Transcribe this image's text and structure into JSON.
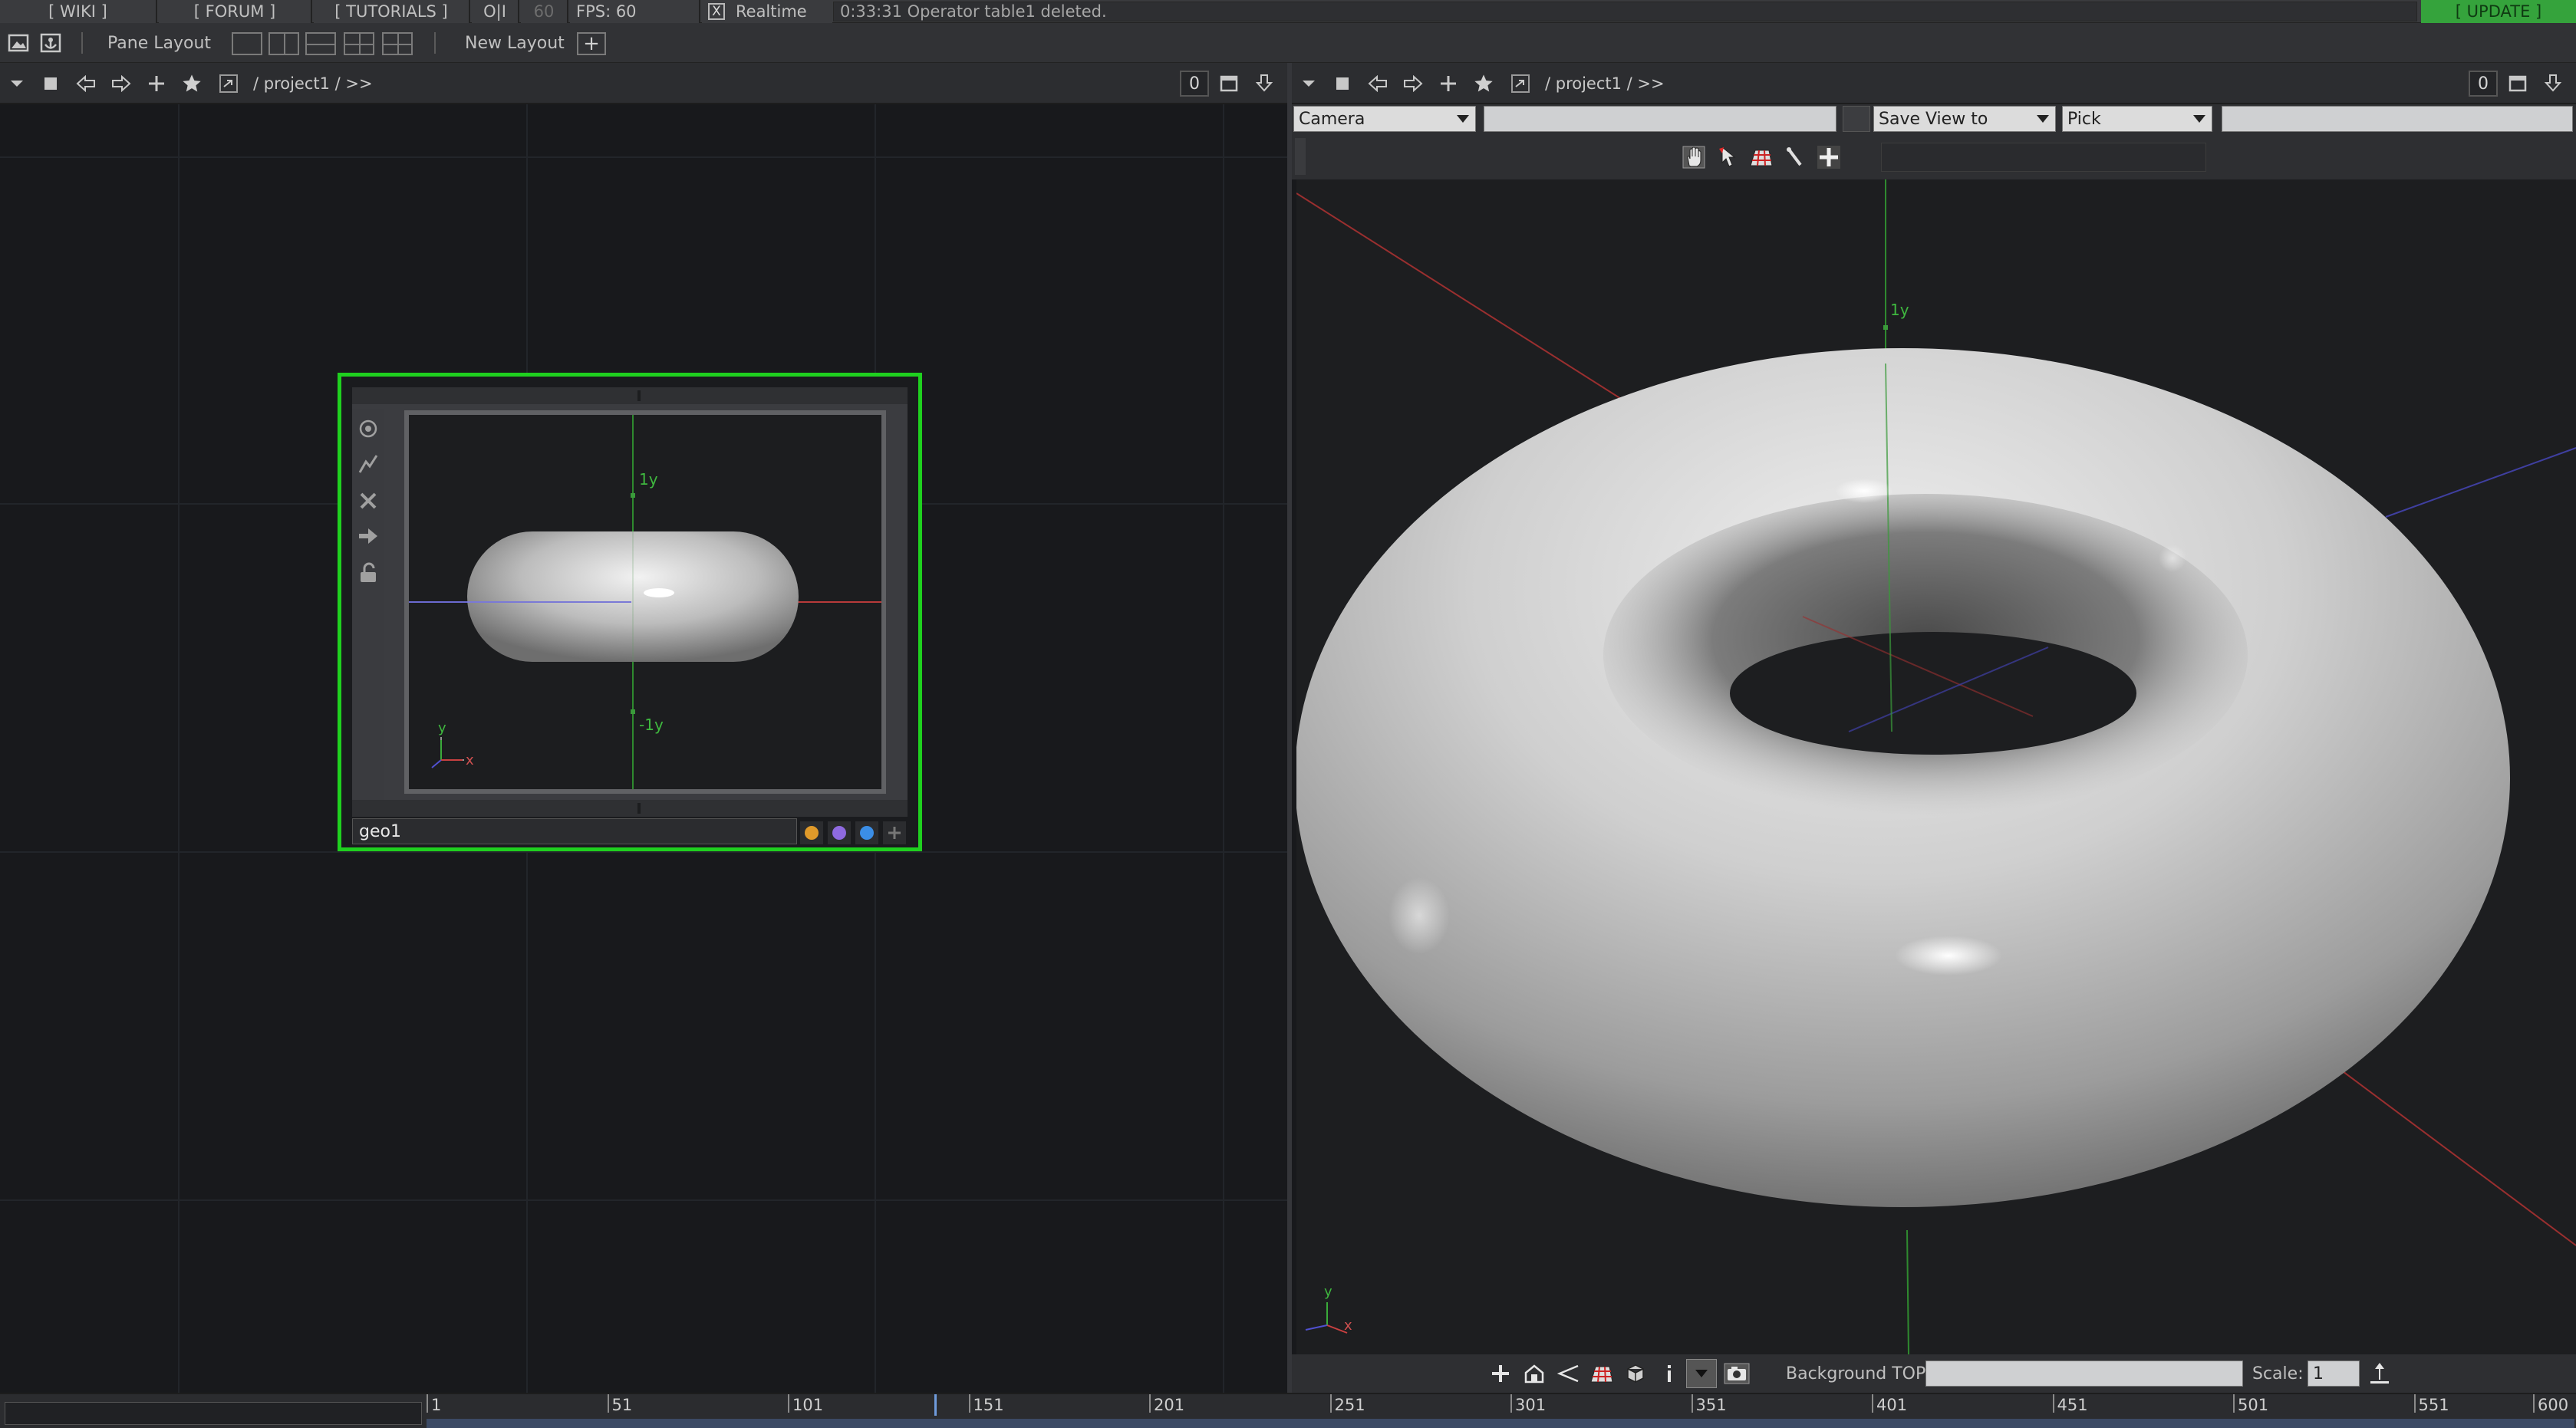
{
  "topbar": {
    "wiki": "[ WIKI ]",
    "forum": "[ FORUM ]",
    "tutorials": "[ TUTORIALS ]",
    "oi": "O|I",
    "fps_cap": "60",
    "fps": "FPS:  60",
    "realtime_check": "X",
    "realtime": "Realtime",
    "status": "0:33:31 Operator table1 deleted.",
    "update": "[ UPDATE ]"
  },
  "toolbar": {
    "pane_layout": "Pane Layout",
    "new_layout": "New Layout",
    "add": "+"
  },
  "left_pane": {
    "path": "/  project1  /  >>",
    "counter": "0"
  },
  "right_pane": {
    "path": "/  project1  /  >>",
    "counter": "0",
    "camera": "Camera",
    "save_view": "Save View to",
    "pick": "Pick",
    "background_top": "Background TOP:",
    "scale_label": "Scale:",
    "scale_value": "1"
  },
  "node": {
    "name": "geo1",
    "axis_top": "1y",
    "axis_bottom": "-1y",
    "gizmo_y": "y",
    "gizmo_x": "x",
    "flag_colors": [
      "#e09a2a",
      "#8f6ae0",
      "#3b8ee6"
    ]
  },
  "viewer": {
    "axis_top": "1y",
    "gizmo_y": "y",
    "gizmo_x": "x"
  },
  "timeline": {
    "ticks": [
      "1",
      "51",
      "101",
      "151",
      "201",
      "251",
      "301",
      "351",
      "401",
      "451",
      "501",
      "551",
      "600"
    ]
  },
  "colors": {
    "node_border": "#1fd01f",
    "update": "#35a33c",
    "accent_blue": "#6f9bdc"
  }
}
